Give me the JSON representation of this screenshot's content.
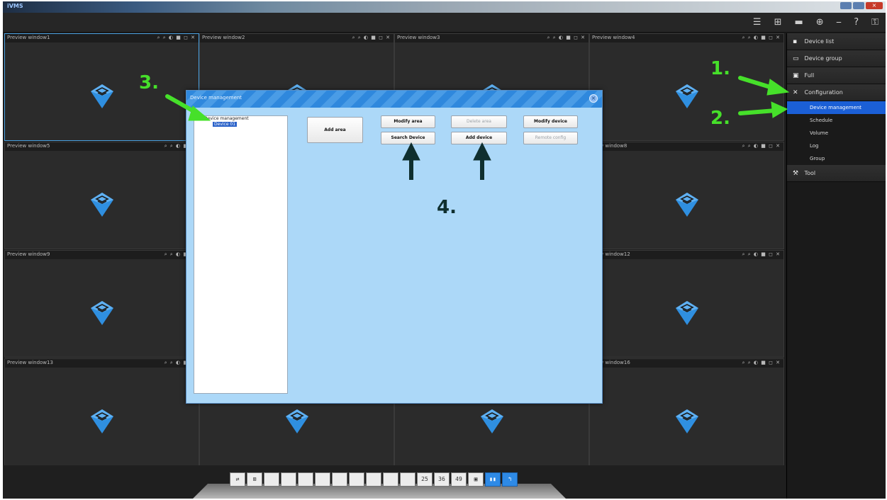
{
  "window": {
    "title": "iVMS",
    "min": "",
    "max": "",
    "close": "×"
  },
  "toolbar": {
    "icons": [
      "menu-icon",
      "layout-icon",
      "camera-icon",
      "settings-icon",
      "minimize-icon",
      "help-icon",
      "lock-icon"
    ],
    "glyphs": [
      "☰",
      "⊞",
      "▬",
      "⊕",
      "⎯",
      "?",
      "⚿"
    ]
  },
  "grid": {
    "cells": [
      {
        "title": "Preview window1",
        "icons": "⌕ ⌕ ◐ ■ ◻ ✕"
      },
      {
        "title": "Preview window2",
        "icons": "⌕ ⌕ ◐ ■ ◻ ✕"
      },
      {
        "title": "Preview window3",
        "icons": "⌕ ⌕ ◐ ■ ◻ ✕"
      },
      {
        "title": "Preview window4",
        "icons": "⌕ ⌕ ◐ ■ ◻ ✕"
      },
      {
        "title": "Preview window5",
        "icons": "⌕ ⌕ ◐ ■ ◻"
      },
      {
        "title": "",
        "icons": ""
      },
      {
        "title": "",
        "icons": ""
      },
      {
        "title": "view window8",
        "icons": "⌕ ⌕ ◐ ■ ◻ ✕"
      },
      {
        "title": "Preview window9",
        "icons": "⌕ ⌕ ◐ ■ ◻"
      },
      {
        "title": "",
        "icons": ""
      },
      {
        "title": "",
        "icons": ""
      },
      {
        "title": "view window12",
        "icons": "⌕ ⌕ ◐ ■ ◻ ✕"
      },
      {
        "title": "Preview window13",
        "icons": "⌕ ⌕ ◐ ■ ◻"
      },
      {
        "title": "",
        "icons": ""
      },
      {
        "title": "",
        "icons": ""
      },
      {
        "title": "view window16",
        "icons": "⌕ ⌕ ◐ ■ ◻ ✕"
      }
    ]
  },
  "layouts": {
    "buttons": [
      "⇄",
      "⊠",
      "",
      "",
      "",
      "",
      "",
      "",
      "",
      "",
      "",
      "25",
      "36",
      "49",
      "▣",
      "▮▮",
      "↰"
    ]
  },
  "rightpanel": {
    "items": [
      {
        "label": "Device list",
        "icon": "▪"
      },
      {
        "label": "Device group",
        "icon": "▭"
      },
      {
        "label": "Full",
        "icon": "▣"
      },
      {
        "label": "Configuration",
        "icon": "✕"
      }
    ],
    "subitems": [
      {
        "label": "Device management"
      },
      {
        "label": "Schedule"
      },
      {
        "label": "Volume"
      },
      {
        "label": "Log"
      },
      {
        "label": "Group"
      }
    ],
    "tool": {
      "label": "Tool",
      "icon": "⚒"
    }
  },
  "dialog": {
    "title": "Device management",
    "close": "×",
    "tree_root": "Device management",
    "tree_child": "Device 01",
    "buttons": {
      "add_area": "Add area",
      "modify_area": "Modify area",
      "search_device": "Search Device",
      "add_device": "Add device",
      "modify_device": "Modify device",
      "delete_device": "Delete device",
      "delete_area": "Delete area",
      "remote_config": "Remote config"
    }
  },
  "annotations": {
    "step1": "1.",
    "step2": "2.",
    "step3": "3.",
    "step4": "4."
  },
  "colors": {
    "accent": "#1b5fd6",
    "dialog_bg": "#acd8f8",
    "annotation_green": "#46e02a",
    "camera_icon": "#2f8fe0"
  }
}
